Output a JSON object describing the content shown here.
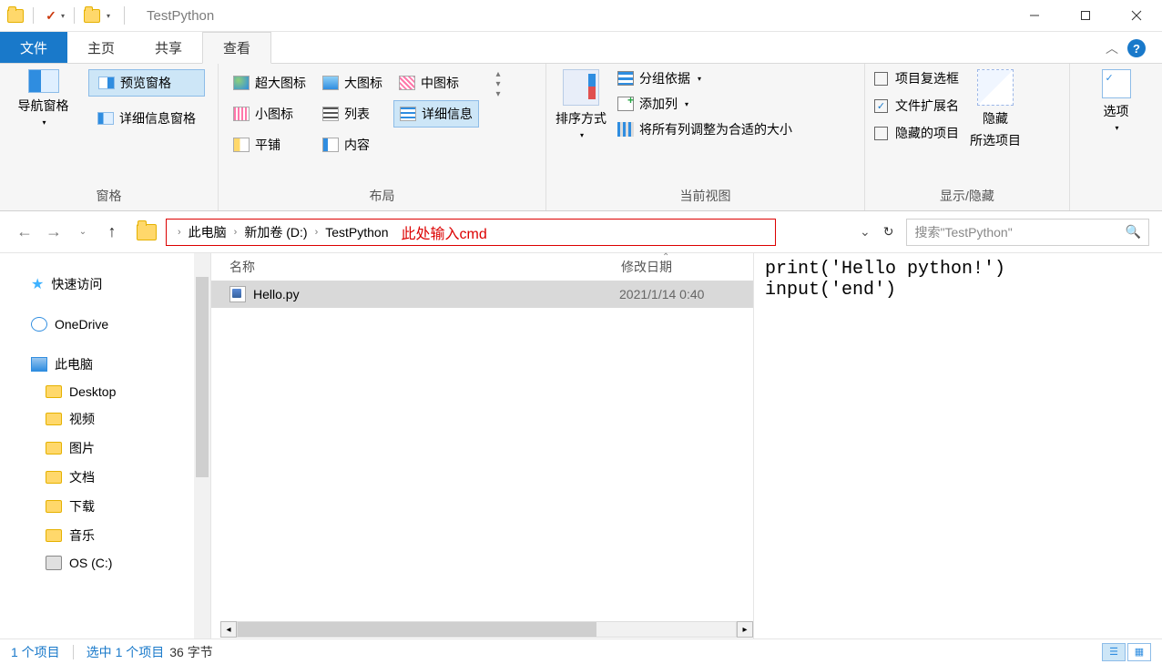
{
  "window": {
    "title": "TestPython",
    "minimize": "—",
    "maximize": "☐",
    "close": "✕"
  },
  "tabs": {
    "file": "文件",
    "home": "主页",
    "share": "共享",
    "view": "查看"
  },
  "ribbon": {
    "panes": {
      "nav": "导航窗格",
      "preview": "预览窗格",
      "details": "详细信息窗格",
      "group_label": "窗格"
    },
    "layout": {
      "xl": "超大图标",
      "lg": "大图标",
      "md": "中图标",
      "sm": "小图标",
      "list": "列表",
      "details": "详细信息",
      "tiles": "平铺",
      "content": "内容",
      "group_label": "布局"
    },
    "current_view": {
      "sort": "排序方式",
      "group_by": "分组依据",
      "add_col": "添加列",
      "autosize": "将所有列调整为合适的大小",
      "group_label": "当前视图"
    },
    "show_hide": {
      "checkboxes": "项目复选框",
      "extensions": "文件扩展名",
      "hidden": "隐藏的项目",
      "hide_btn_l1": "隐藏",
      "hide_btn_l2": "所选项目",
      "group_label": "显示/隐藏",
      "ext_checked": "✓"
    },
    "options": {
      "label": "选项"
    }
  },
  "addr": {
    "back": "←",
    "forward": "→",
    "up": "↑",
    "crumbs": {
      "root": "此电脑",
      "drive": "新加卷 (D:)",
      "folder": "TestPython"
    },
    "annotation": "此处输入cmd",
    "refresh": "↻",
    "search_placeholder": "搜索\"TestPython\""
  },
  "tree": {
    "quick": "快速访问",
    "onedrive": "OneDrive",
    "pc": "此电脑",
    "desktop": "Desktop",
    "videos": "视频",
    "pictures": "图片",
    "documents": "文档",
    "downloads": "下载",
    "music": "音乐",
    "osc": "OS (C:)"
  },
  "columns": {
    "name": "名称",
    "date": "修改日期"
  },
  "files": [
    {
      "name": "Hello.py",
      "date": "2021/1/14 0:40"
    }
  ],
  "preview_text": "print('Hello python!')\ninput('end')",
  "status": {
    "items": "1 个项目",
    "selected": "选中 1 个项目",
    "size": "36 字节"
  }
}
